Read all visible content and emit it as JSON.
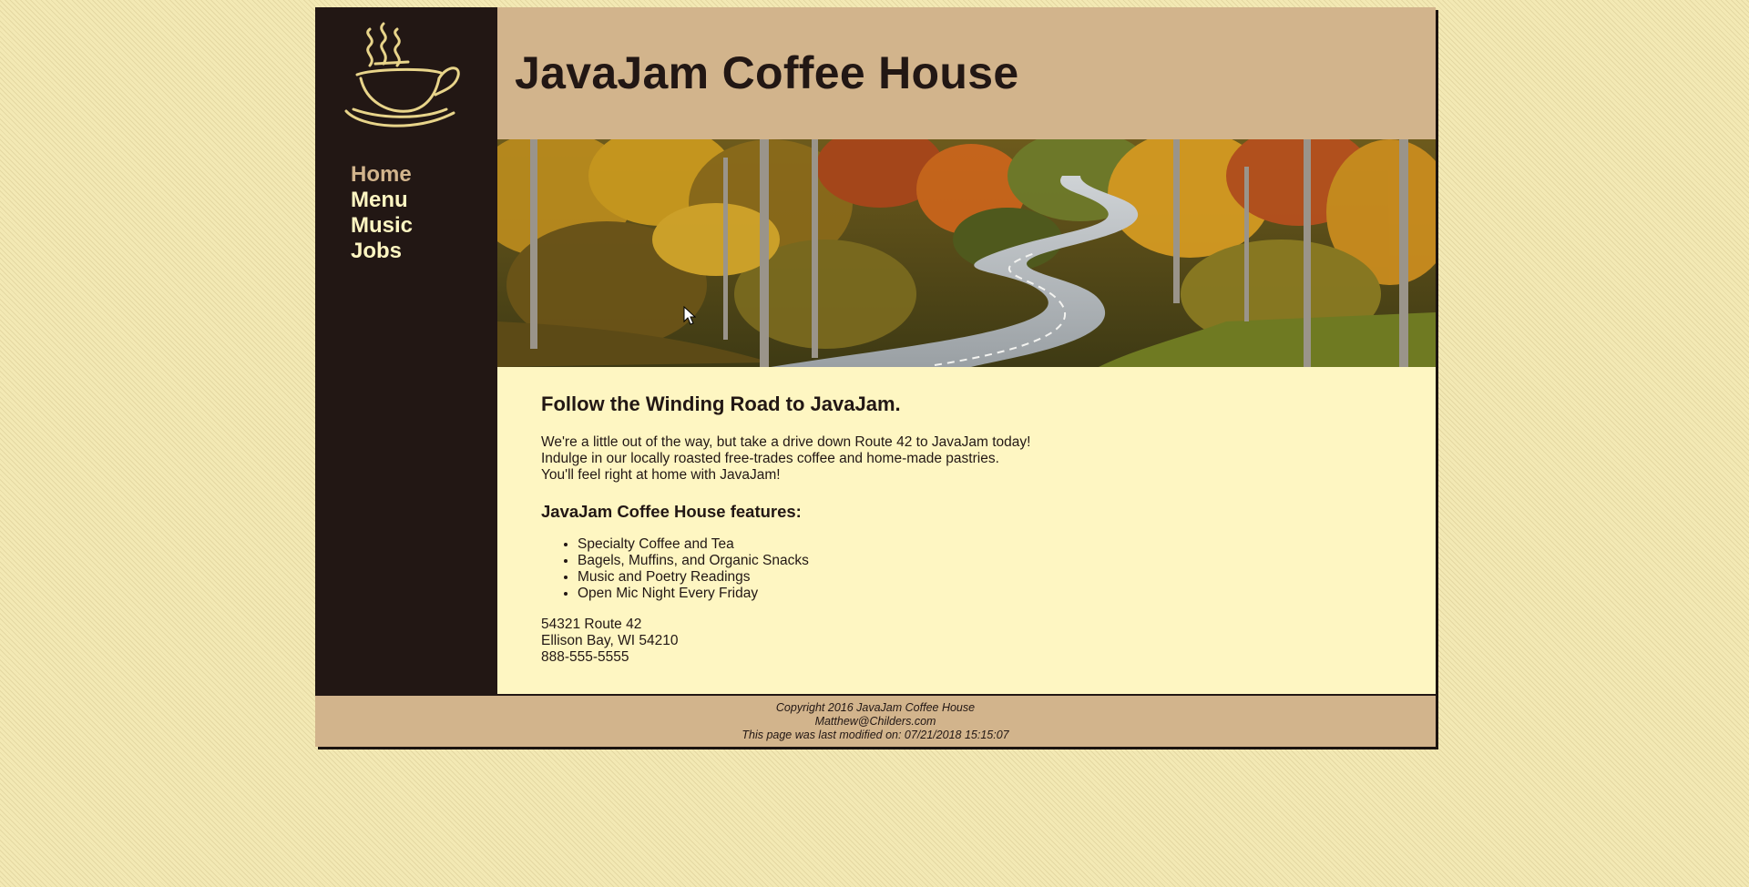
{
  "site": {
    "title": "JavaJam Coffee House"
  },
  "nav": {
    "items": [
      {
        "label": "Home",
        "active": true
      },
      {
        "label": "Menu",
        "active": false
      },
      {
        "label": "Music",
        "active": false
      },
      {
        "label": "Jobs",
        "active": false
      }
    ]
  },
  "content": {
    "heading": "Follow the Winding Road to JavaJam.",
    "intro_lines": [
      "We're a little out of the way, but take a drive down Route 42 to JavaJam today!",
      "Indulge in our locally roasted free-trades coffee and home-made pastries.",
      "You'll feel right at home with JavaJam!"
    ],
    "features_heading": "JavaJam Coffee House features:",
    "features": [
      "Specialty Coffee and Tea",
      "Bagels, Muffins, and Organic Snacks",
      "Music and Poetry Readings",
      "Open Mic Night Every Friday"
    ],
    "address_lines": [
      "54321 Route 42",
      "Ellison Bay, WI 54210",
      "888-555-5555"
    ]
  },
  "footer": {
    "copyright": "Copyright 2016 JavaJam Coffee House",
    "email": "Matthew@Childers.com",
    "last_modified": "This page was last modified on: 07/21/2018 15:15:07"
  },
  "icons": {
    "logo": "coffee-cup-steam-icon",
    "cursor": "mouse-pointer-icon"
  },
  "colors": {
    "dark_brown": "#221714",
    "tan": "#d2b48c",
    "cream": "#fef6c2",
    "nav_text": "#fef6c2",
    "nav_active": "#d2b48c"
  }
}
